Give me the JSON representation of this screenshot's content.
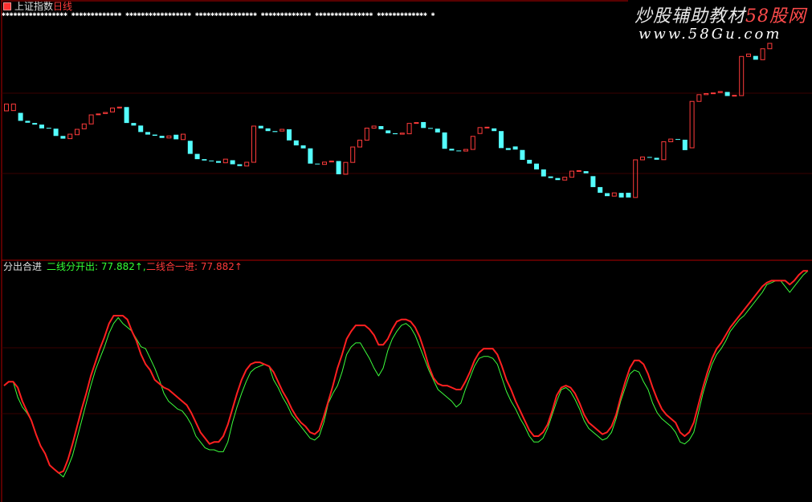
{
  "header": {
    "title": "上证指数",
    "period": "日线",
    "star_row": "✱✱✱✱✱✱✱✱✱✱✱✱✱✱✱✱✱ ✱✱✱✱✱✱✱✱✱✱✱✱✱ ✱✱✱✱✱✱✱✱✱✱✱✱✱✱✱✱✱ ✱✱✱✱✱✱✱✱✱✱✱✱✱✱✱✱ ✱✱✱✱✱✱✱✱✱✱✱✱✱ ✱✱✱✱✱✱✱✱✱✱✱✱✱✱✱ ✱✱✱✱✱✱✱✱✱✱✱✱✱ ✱"
  },
  "watermark": {
    "line1_a": "炒股辅助教材",
    "line1_b": "58股网",
    "line2": "www.58Gu.com"
  },
  "indicator": {
    "name": "分出合进",
    "series1_text": "二线分开出: 77.882↑,",
    "series2_text": "二线合一进: 77.882↑"
  },
  "colors": {
    "background": "#000000",
    "up_candle": "#ff3b3b",
    "down_candle": "#54ffff",
    "line_green": "#3cff3c",
    "line_red": "#ff2020",
    "frame": "#b00000"
  },
  "chart_data": [
    {
      "type": "candlestick",
      "candles": [
        {
          "o": 25.0,
          "c": 30.0,
          "h": 30.0,
          "l": 25.0
        },
        {
          "o": 25.2,
          "c": 30.0,
          "h": 30.0,
          "l": 25.2
        },
        {
          "o": 23.5,
          "c": 17.6,
          "h": 23.5,
          "l": 17.6
        },
        {
          "o": 17.6,
          "c": 16.2,
          "h": 17.6,
          "l": 16.2
        },
        {
          "o": 16.0,
          "c": 14.8,
          "h": 16.0,
          "l": 14.8
        },
        {
          "o": 14.8,
          "c": 12.0,
          "h": 14.8,
          "l": 12.0
        },
        {
          "o": 12.4,
          "c": 12.0,
          "h": 12.4,
          "l": 12.0
        },
        {
          "o": 11.8,
          "c": 6.4,
          "h": 11.8,
          "l": 6.4
        },
        {
          "o": 6.4,
          "c": 4.4,
          "h": 6.4,
          "l": 4.4
        },
        {
          "o": 4.4,
          "c": 7.7,
          "h": 7.7,
          "l": 4.4
        },
        {
          "o": 7.3,
          "c": 11.3,
          "h": 11.3,
          "l": 7.3
        },
        {
          "o": 11.7,
          "c": 15.3,
          "h": 15.3,
          "l": 11.7
        },
        {
          "o": 15.3,
          "c": 22.0,
          "h": 22.0,
          "l": 15.3
        },
        {
          "o": 22.3,
          "c": 22.7,
          "h": 22.7,
          "l": 22.3
        },
        {
          "o": 23.0,
          "c": 23.8,
          "h": 23.8,
          "l": 23.0
        },
        {
          "o": 24.2,
          "c": 27.1,
          "h": 27.1,
          "l": 24.2
        },
        {
          "o": 27.1,
          "c": 27.8,
          "h": 27.8,
          "l": 27.1
        },
        {
          "o": 27.8,
          "c": 16.0,
          "h": 27.8,
          "l": 16.0
        },
        {
          "o": 16.0,
          "c": 14.1,
          "h": 16.0,
          "l": 14.1
        },
        {
          "o": 14.1,
          "c": 9.3,
          "h": 14.1,
          "l": 9.3
        },
        {
          "o": 9.3,
          "c": 7.4,
          "h": 9.3,
          "l": 7.4
        },
        {
          "o": 7.4,
          "c": 6.5,
          "h": 7.4,
          "l": 6.5
        },
        {
          "o": 6.5,
          "c": 4.9,
          "h": 6.5,
          "l": 4.9
        },
        {
          "o": 4.9,
          "c": 6.4,
          "h": 6.4,
          "l": 4.9
        },
        {
          "o": 7.3,
          "c": 3.9,
          "h": 7.3,
          "l": 3.9
        },
        {
          "o": 3.7,
          "c": 7.7,
          "h": 7.7,
          "l": 3.7
        },
        {
          "o": 2.8,
          "c": -6.9,
          "h": 2.8,
          "l": -6.9
        },
        {
          "o": -6.9,
          "c": -10.8,
          "h": -6.9,
          "l": -10.8
        },
        {
          "o": -10.8,
          "c": -11.8,
          "h": -10.8,
          "l": -11.8
        },
        {
          "o": -11.8,
          "c": -12.2,
          "h": -11.8,
          "l": -12.2
        },
        {
          "o": -12.2,
          "c": -13.5,
          "h": -12.2,
          "l": -13.5
        },
        {
          "o": -13.5,
          "c": -10.8,
          "h": -10.8,
          "l": -13.5
        },
        {
          "o": -11.6,
          "c": -14.6,
          "h": -11.6,
          "l": -14.6
        },
        {
          "o": -14.6,
          "c": -15.9,
          "h": -14.6,
          "l": -15.9
        },
        {
          "o": -15.9,
          "c": -13.1,
          "h": -13.1,
          "l": -15.9
        },
        {
          "o": -13.1,
          "c": 13.7,
          "h": 13.7,
          "l": -13.1
        },
        {
          "o": 13.9,
          "c": 12.0,
          "h": 13.9,
          "l": 12.0
        },
        {
          "o": 12.0,
          "c": 10.0,
          "h": 12.0,
          "l": 10.0
        },
        {
          "o": 10.0,
          "c": 9.3,
          "h": 10.0,
          "l": 9.3
        },
        {
          "o": 10.0,
          "c": 11.3,
          "h": 11.3,
          "l": 10.0
        },
        {
          "o": 11.3,
          "c": 3.1,
          "h": 11.3,
          "l": 3.1
        },
        {
          "o": 3.1,
          "c": -0.6,
          "h": 3.1,
          "l": -0.6
        },
        {
          "o": -0.6,
          "c": -2.8,
          "h": -0.6,
          "l": -2.8
        },
        {
          "o": -2.8,
          "c": -14.1,
          "h": -2.8,
          "l": -14.1
        },
        {
          "o": -14.1,
          "c": -14.7,
          "h": -14.1,
          "l": -14.7
        },
        {
          "o": -14.7,
          "c": -13.0,
          "h": -13.0,
          "l": -14.7
        },
        {
          "o": -12.9,
          "c": -12.2,
          "h": -12.2,
          "l": -12.9
        },
        {
          "o": -12.2,
          "c": -22.0,
          "h": -12.2,
          "l": -22.0
        },
        {
          "o": -22.0,
          "c": -13.2,
          "h": -13.2,
          "l": -22.0
        },
        {
          "o": -13.2,
          "c": -1.8,
          "h": -1.8,
          "l": -13.2
        },
        {
          "o": -1.8,
          "c": 3.3,
          "h": 3.3,
          "l": -1.8
        },
        {
          "o": 3.3,
          "c": 12.2,
          "h": 12.2,
          "l": 3.3
        },
        {
          "o": 12.2,
          "c": 13.7,
          "h": 13.7,
          "l": 12.2
        },
        {
          "o": 13.7,
          "c": 11.4,
          "h": 13.7,
          "l": 11.4
        },
        {
          "o": 10.5,
          "c": 8.4,
          "h": 10.5,
          "l": 8.4
        },
        {
          "o": 8.4,
          "c": 7.7,
          "h": 8.4,
          "l": 7.7
        },
        {
          "o": 7.7,
          "c": 8.5,
          "h": 8.5,
          "l": 7.7
        },
        {
          "o": 8.0,
          "c": 15.7,
          "h": 15.7,
          "l": 8.0
        },
        {
          "o": 15.7,
          "c": 16.3,
          "h": 16.3,
          "l": 15.7
        },
        {
          "o": 16.7,
          "c": 12.3,
          "h": 16.7,
          "l": 12.3
        },
        {
          "o": 12.3,
          "c": 11.8,
          "h": 12.3,
          "l": 11.8
        },
        {
          "o": 11.8,
          "c": 9.0,
          "h": 11.8,
          "l": 9.0
        },
        {
          "o": 9.0,
          "c": -3.1,
          "h": 9.0,
          "l": -3.1
        },
        {
          "o": -3.1,
          "c": -4.4,
          "h": -3.1,
          "l": -4.4
        },
        {
          "o": -4.4,
          "c": -4.8,
          "h": -4.4,
          "l": -4.8
        },
        {
          "o": -4.8,
          "c": -3.6,
          "h": -3.6,
          "l": -4.8
        },
        {
          "o": -3.6,
          "c": 6.1,
          "h": 6.1,
          "l": -3.6
        },
        {
          "o": 8.2,
          "c": 12.6,
          "h": 12.6,
          "l": 8.2
        },
        {
          "o": 12.6,
          "c": 12.9,
          "h": 12.9,
          "l": 12.6
        },
        {
          "o": 12.0,
          "c": 10.0,
          "h": 12.0,
          "l": 10.0
        },
        {
          "o": 10.0,
          "c": -2.6,
          "h": 10.0,
          "l": -2.6
        },
        {
          "o": -2.6,
          "c": -4.0,
          "h": -2.6,
          "l": -4.0
        },
        {
          "o": -1.4,
          "c": -3.7,
          "h": -1.4,
          "l": -3.7
        },
        {
          "o": -4.0,
          "c": -11.3,
          "h": -4.0,
          "l": -11.3
        },
        {
          "o": -11.3,
          "c": -14.1,
          "h": -11.3,
          "l": -14.1
        },
        {
          "o": -14.1,
          "c": -18.4,
          "h": -14.1,
          "l": -18.4
        },
        {
          "o": -18.4,
          "c": -23.6,
          "h": -18.4,
          "l": -23.6
        },
        {
          "o": -23.6,
          "c": -24.8,
          "h": -23.6,
          "l": -24.8
        },
        {
          "o": -24.8,
          "c": -26.3,
          "h": -24.8,
          "l": -26.3
        },
        {
          "o": -26.3,
          "c": -24.2,
          "h": -24.2,
          "l": -26.3
        },
        {
          "o": -24.2,
          "c": -19.7,
          "h": -19.7,
          "l": -24.2
        },
        {
          "o": -19.7,
          "c": -19.3,
          "h": -19.3,
          "l": -19.7
        },
        {
          "o": -19.7,
          "c": -21.3,
          "h": -19.7,
          "l": -21.3
        },
        {
          "o": -23.4,
          "c": -31.5,
          "h": -23.4,
          "l": -31.5
        },
        {
          "o": -31.5,
          "c": -35.7,
          "h": -31.5,
          "l": -35.7
        },
        {
          "o": -36.0,
          "c": -38.2,
          "h": -36.0,
          "l": -38.2
        },
        {
          "o": -38.2,
          "c": -35.8,
          "h": -35.8,
          "l": -38.2
        },
        {
          "o": -35.8,
          "c": -39.2,
          "h": -35.8,
          "l": -39.2
        },
        {
          "o": -35.7,
          "c": -39.2,
          "h": -35.7,
          "l": -39.2
        },
        {
          "o": -39.2,
          "c": -11.3,
          "h": -11.3,
          "l": -39.2
        },
        {
          "o": -11.3,
          "c": -9.2,
          "h": -9.2,
          "l": -11.3
        },
        {
          "o": -9.2,
          "c": -9.3,
          "h": -9.2,
          "l": -9.3
        },
        {
          "o": -9.8,
          "c": -11.2,
          "h": -9.8,
          "l": -11.2
        },
        {
          "o": -11.2,
          "c": 2.1,
          "h": 2.1,
          "l": -11.2
        },
        {
          "o": 2.1,
          "c": 4.1,
          "h": 4.1,
          "l": 2.1
        },
        {
          "o": 4.1,
          "c": 3.6,
          "h": 4.1,
          "l": 3.6
        },
        {
          "o": 3.6,
          "c": -4.1,
          "h": 3.6,
          "l": -4.1
        },
        {
          "o": -2.4,
          "c": 32.0,
          "h": 32.0,
          "l": -2.4
        },
        {
          "o": 32.0,
          "c": 37.0,
          "h": 37.0,
          "l": 32.0
        },
        {
          "o": 37.0,
          "c": 37.8,
          "h": 37.8,
          "l": 37.0
        },
        {
          "o": 37.8,
          "c": 38.3,
          "h": 38.3,
          "l": 37.8
        },
        {
          "o": 38.6,
          "c": 39.3,
          "h": 39.3,
          "l": 38.6
        },
        {
          "o": 39.0,
          "c": 36.0,
          "h": 39.0,
          "l": 36.0
        },
        {
          "o": 36.0,
          "c": 36.5,
          "h": 36.5,
          "l": 36.0
        },
        {
          "o": 36.3,
          "c": 65.3,
          "h": 65.3,
          "l": 36.3
        },
        {
          "o": 65.3,
          "c": 67.1,
          "h": 67.1,
          "l": 65.3
        },
        {
          "o": 65.7,
          "c": 62.9,
          "h": 65.7,
          "l": 62.9
        },
        {
          "o": 62.9,
          "c": 71.0,
          "h": 71.0,
          "l": 62.9
        },
        {
          "o": 71.0,
          "c": 75.0,
          "h": 75.0,
          "l": 71.0
        }
      ]
    },
    {
      "type": "line",
      "name": "分出合进",
      "series": [
        {
          "name": "二线分开出",
          "color": "#3cff3c",
          "values": [
            64,
            66,
            66,
            58,
            53,
            50,
            46,
            39,
            33,
            29,
            23,
            21,
            19,
            17,
            22,
            28,
            37,
            46,
            55,
            64,
            72,
            78,
            84,
            91,
            96,
            99,
            96,
            94,
            92,
            88,
            84,
            83,
            78,
            73,
            67,
            60,
            56,
            54,
            52,
            51,
            48,
            44,
            38,
            35,
            32,
            31,
            31,
            30,
            30,
            35,
            45,
            53,
            60,
            66,
            71,
            73,
            74,
            75,
            74,
            67,
            63,
            58,
            54,
            49,
            46,
            43,
            40,
            37,
            36,
            38,
            45,
            55,
            60,
            64,
            71,
            80,
            84,
            86,
            86,
            82,
            78,
            73,
            69,
            73,
            82,
            88,
            92,
            95,
            96,
            94,
            90,
            84,
            78,
            72,
            67,
            62,
            60,
            58,
            56,
            53,
            55,
            62,
            68,
            74,
            78,
            79,
            79,
            78,
            75,
            68,
            61,
            56,
            52,
            47,
            43,
            38,
            35,
            35,
            37,
            42,
            49,
            56,
            62,
            63,
            61,
            57,
            52,
            46,
            42,
            40,
            38,
            36,
            37,
            40,
            47,
            56,
            63,
            70,
            72,
            71,
            66,
            62,
            55,
            50,
            47,
            45,
            43,
            40,
            35,
            34,
            36,
            40,
            50,
            60,
            68,
            75,
            80,
            83,
            87,
            92,
            95,
            98,
            100,
            103,
            106,
            109,
            112,
            116,
            117,
            118,
            118,
            115,
            112,
            115,
            118,
            121,
            123
          ]
        },
        {
          "name": "二线合一进",
          "color": "#ff2020",
          "values": [
            64,
            66,
            66,
            63,
            56,
            51,
            46,
            39,
            33,
            29,
            23,
            21,
            19,
            20,
            26,
            34,
            43,
            52,
            60,
            69,
            76,
            83,
            89,
            96,
            100,
            100,
            100,
            98,
            92,
            87,
            80,
            75,
            72,
            67,
            65,
            63,
            62,
            60,
            58,
            56,
            54,
            50,
            45,
            40,
            37,
            34,
            35,
            35,
            38,
            44,
            52,
            60,
            67,
            72,
            75,
            76,
            76,
            75,
            74,
            71,
            66,
            61,
            57,
            52,
            48,
            45,
            43,
            40,
            39,
            41,
            48,
            56,
            64,
            73,
            80,
            88,
            92,
            95,
            95,
            95,
            93,
            90,
            85,
            85,
            88,
            93,
            97,
            98,
            98,
            97,
            94,
            89,
            82,
            74,
            68,
            65,
            64,
            64,
            63,
            62,
            62,
            66,
            71,
            77,
            81,
            83,
            83,
            83,
            80,
            74,
            67,
            62,
            56,
            51,
            46,
            41,
            38,
            38,
            40,
            44,
            51,
            59,
            63,
            64,
            63,
            60,
            55,
            49,
            45,
            43,
            41,
            39,
            40,
            43,
            49,
            58,
            66,
            73,
            77,
            77,
            75,
            70,
            63,
            57,
            52,
            49,
            47,
            45,
            40,
            38,
            40,
            45,
            54,
            63,
            71,
            78,
            83,
            86,
            90,
            94,
            97,
            100,
            103,
            106,
            109,
            112,
            115,
            117,
            118,
            118,
            118,
            118,
            116,
            118,
            121,
            123,
            123
          ]
        }
      ]
    }
  ]
}
